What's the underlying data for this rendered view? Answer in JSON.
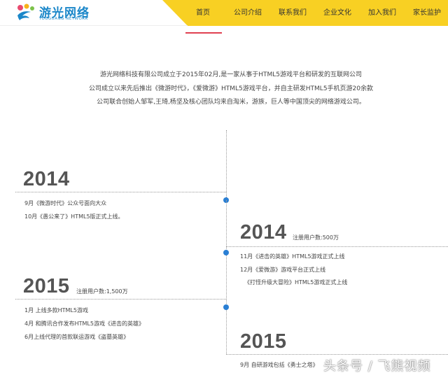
{
  "logo": {
    "title": "游光网络",
    "subtitle": "YOUGUANG NETWORK"
  },
  "colors": {
    "nav_yellow": "#f8d023",
    "active_red": "#e04050",
    "dot_blue": "#2a7fd4",
    "logo_blue": "#1b87c9"
  },
  "nav": {
    "items": [
      {
        "label": "首页"
      },
      {
        "label": "公司介绍"
      },
      {
        "label": "联系我们"
      },
      {
        "label": "企业文化"
      },
      {
        "label": "加入我们"
      },
      {
        "label": "家长监护"
      }
    ]
  },
  "intro": {
    "line1": "游光网络科技有限公司成立于2015年02月,是一家从事于HTML5游戏平台和研发的互联网公司",
    "line2": "公司成立以来先后推出《微游时代》，《爱微游》HTML5游戏平台，并自主研发HTML5手机页游20余款",
    "line3": "公司联合创始人邹军,王琦,杨坚及核心团队均来自淘米，游族，巨人等中国顶尖的网络游戏公司。"
  },
  "timeline": {
    "left_2014": {
      "year": "2014",
      "events": [
        "9月《微游时代》公众号面向大众",
        "10月《愚公来了》HTML5版正式上线。"
      ]
    },
    "right_2014": {
      "year": "2014",
      "users": "注册用户数:500万",
      "events": [
        "11月《进击的英雄》HTML5游戏正式上线",
        "12月《爱微游》游戏平台正式上线",
        "《打怪升级大冒险》HTML5游戏正式上线"
      ]
    },
    "left_2015": {
      "year": "2015",
      "users": "注册用户数:1,500万",
      "events": [
        "1月 上线多款HTML5游戏",
        "4月 和腾讯合作发布HTML5游戏《进击的英雄》",
        "6月上线代理的首款联运游戏《盗墓英雄》"
      ]
    },
    "right_2015": {
      "year": "2015",
      "events": [
        "9月 自研游戏包括《勇士之塔》"
      ]
    }
  },
  "watermark": "头条号 / 飞熊视频"
}
